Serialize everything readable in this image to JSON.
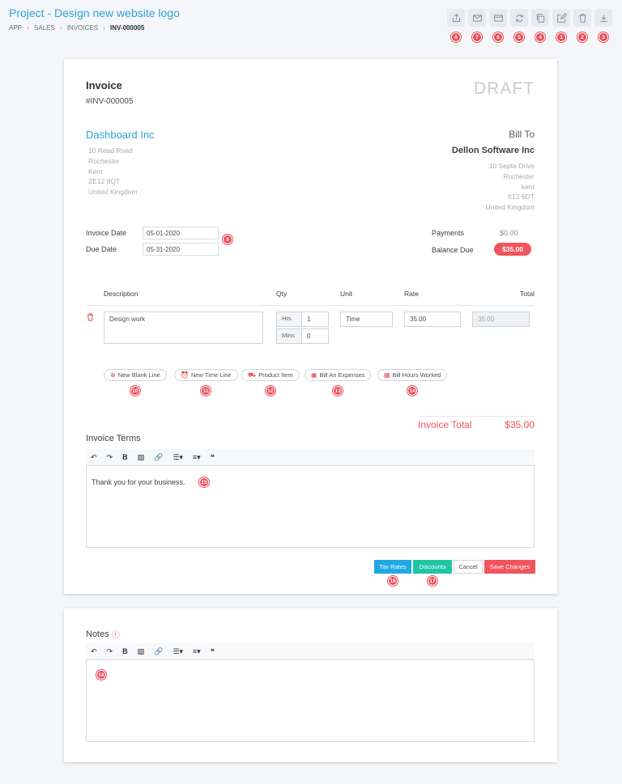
{
  "header": {
    "title": "Project - Design new website logo",
    "breadcrumb": [
      "APP",
      "SALES",
      "INVOICES",
      "INV-000005"
    ]
  },
  "toolbar_buttons": [
    {
      "icon": "share-icon",
      "badge": "8"
    },
    {
      "icon": "email-icon",
      "badge": "7"
    },
    {
      "icon": "credit-card-icon",
      "badge": "6"
    },
    {
      "icon": "refresh-icon",
      "badge": "5"
    },
    {
      "icon": "copy-icon",
      "badge": "4"
    },
    {
      "icon": "edit-icon",
      "badge": "1"
    },
    {
      "icon": "trash-icon",
      "badge": "2"
    },
    {
      "icon": "download-icon",
      "badge": "3"
    }
  ],
  "invoice": {
    "heading": "Invoice",
    "number": "#INV-000005",
    "status": "DRAFT",
    "company": "Dashboard Inc",
    "company_address": [
      "10 Read Road",
      "Rochester",
      "Kent",
      "ZE12 8QT",
      "United Kingdom"
    ],
    "bill_to_label": "Bill To",
    "client": "Dellon Software Inc",
    "client_address": [
      "10 Septa Drive",
      "Rochester",
      "kent",
      "X12 6DT",
      "United Kingdom"
    ],
    "invoice_date_label": "Invoice Date",
    "invoice_date": "05-01-2020",
    "due_date_label": "Due Date",
    "due_date": "05-31-2020",
    "date_badge": "9",
    "payments_label": "Payments",
    "payments": "$0.00",
    "balance_label": "Balance Due",
    "balance": "$35.00"
  },
  "table": {
    "headers": {
      "description": "Description",
      "qty": "Qty",
      "unit": "Unit",
      "rate": "Rate",
      "total": "Total"
    },
    "row": {
      "description": "Design work",
      "hrs_label": "Hrs",
      "hrs": "1",
      "mins_label": "Mins",
      "mins": "0",
      "unit": "Time",
      "rate": "35.00",
      "total": "35.00"
    }
  },
  "line_buttons": [
    {
      "label": "New Blank Line",
      "badge": "10"
    },
    {
      "label": "New Time Line",
      "badge": "11"
    },
    {
      "label": "Product Item",
      "badge": "12"
    },
    {
      "label": "Bill An Expenses",
      "badge": "13"
    },
    {
      "label": "Bill Hours Worked",
      "badge": "14"
    }
  ],
  "totals": {
    "label": "Invoice Total",
    "value": "$35.00"
  },
  "terms": {
    "title": "Invoice Terms",
    "text": "Thank you for your business.",
    "badge": "15"
  },
  "footer_buttons": {
    "tax": "Tax Rates",
    "tax_badge": "16",
    "discounts": "Discounts",
    "discounts_badge": "17",
    "cancel": "Cancel",
    "save": "Save Changes"
  },
  "notes": {
    "title": "Notes",
    "badge": "18"
  },
  "colors": {
    "accent": "#2ea3d8",
    "danger": "#f2545d",
    "teal": "#1fc6a4",
    "blue": "#1fa9e1"
  }
}
